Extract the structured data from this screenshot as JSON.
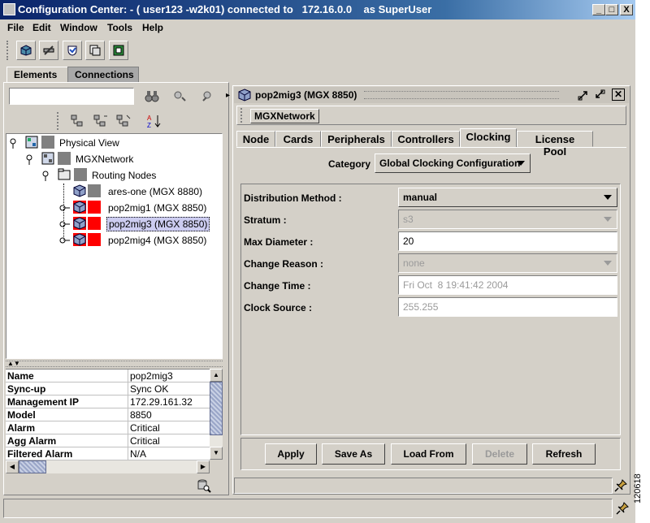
{
  "window": {
    "title": "Configuration Center: - ( user123 -w2k01) connected to   172.16.0.0    as SuperUser",
    "minimize": "_",
    "maximize": "□",
    "close": "X"
  },
  "menu": [
    "File",
    "Edit",
    "Window",
    "Tools",
    "Help"
  ],
  "toolbar_icons": [
    "cube-icon",
    "wrench-icon",
    "shield-icon",
    "clipboard-icon",
    "map-icon"
  ],
  "left_tabs": [
    "Elements",
    "Connections"
  ],
  "search": {
    "value": "",
    "placeholder": ""
  },
  "tree": {
    "root": "Physical View",
    "network": "MGXNetwork",
    "group": "Routing Nodes",
    "nodes": [
      {
        "label": "ares-one (MGX 8880)",
        "alarm": "#808080"
      },
      {
        "label": "pop2mig1 (MGX 8850)",
        "alarm": "#ff0000"
      },
      {
        "label": "pop2mig3 (MGX 8850)",
        "alarm": "#ff0000",
        "selected": true
      },
      {
        "label": "pop2mig4 (MGX 8850)",
        "alarm": "#ff0000"
      }
    ]
  },
  "properties": [
    {
      "key": "Name",
      "value": "pop2mig3"
    },
    {
      "key": "Sync-up",
      "value": "Sync OK"
    },
    {
      "key": "Management IP",
      "value": "172.29.161.32"
    },
    {
      "key": "Model",
      "value": "8850"
    },
    {
      "key": "Alarm",
      "value": "Critical"
    },
    {
      "key": "Agg Alarm",
      "value": "Critical"
    },
    {
      "key": "Filtered Alarm",
      "value": "N/A"
    }
  ],
  "detail": {
    "title": "pop2mig3 (MGX 8850)",
    "breadcrumb": "MGXNetwork",
    "tabs": [
      "Node",
      "Cards",
      "Peripherals",
      "Controllers",
      "Clocking",
      "License Pool"
    ],
    "active_tab": "Clocking",
    "category_label": "Category",
    "category_value": "Global Clocking Configuration",
    "fields": [
      {
        "label": "Distribution Method :",
        "value": "manual"
      },
      {
        "label": "Stratum :",
        "value": "s3"
      },
      {
        "label": "Max Diameter :",
        "value": "20"
      },
      {
        "label": "Change Reason :",
        "value": "none"
      },
      {
        "label": "Change Time :",
        "value": "Fri Oct  8 19:41:42 2004"
      },
      {
        "label": "Clock Source :",
        "value": "255.255"
      }
    ],
    "buttons": [
      "Apply",
      "Save As",
      "Load From",
      "Delete",
      "Refresh"
    ]
  },
  "figure_id": "120618"
}
